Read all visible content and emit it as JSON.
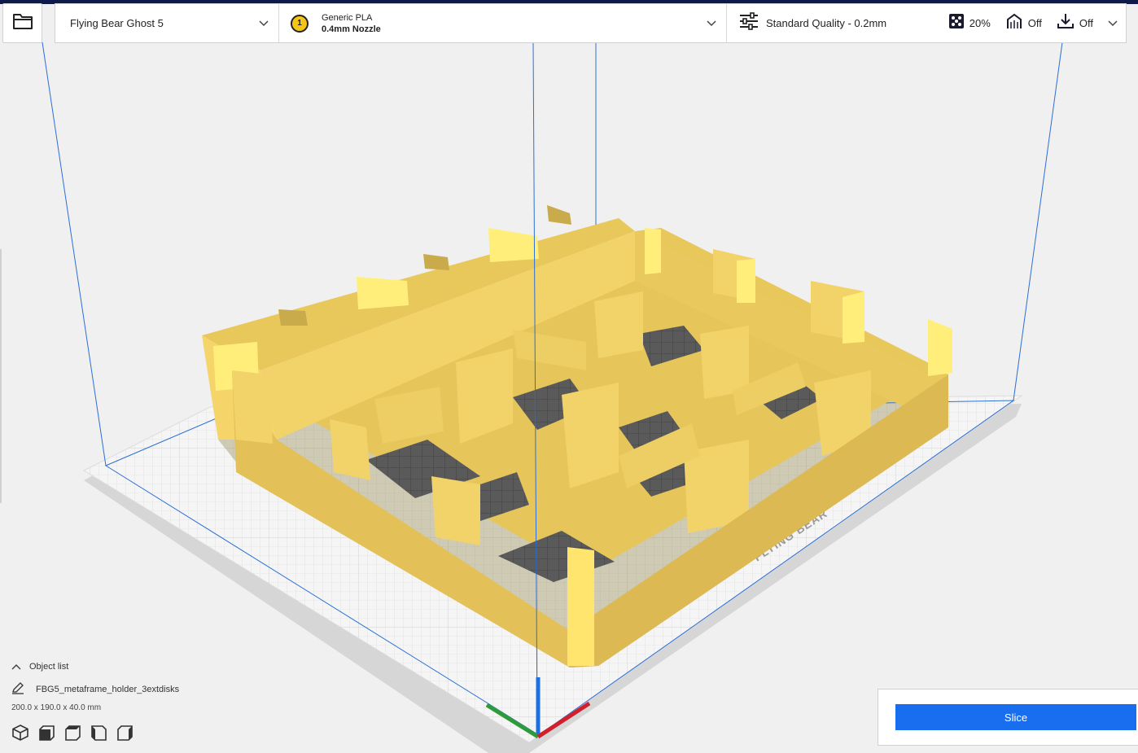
{
  "colors": {
    "accent": "#196ef0",
    "model_fill": "#f7d86a",
    "plate": "#f4f4f4",
    "grid_line": "#c8c8c8",
    "build_volume_line": "#2b6fd6",
    "header_bar": "#0d1a4a",
    "axis_x": "#d0202e",
    "axis_y": "#2e9a3a",
    "axis_z": "#1f6fe0"
  },
  "toolbar": {
    "open_icon": "folder-icon",
    "printer": {
      "name": "Flying Bear Ghost 5",
      "dropdown_icon": "chevron-down-icon"
    },
    "material": {
      "extruder_number": "1",
      "name": "Generic PLA",
      "nozzle": "0.4mm Nozzle",
      "dropdown_icon": "chevron-down-icon"
    },
    "print_settings": {
      "profile": "Standard Quality - 0.2mm",
      "profile_icon": "sliders-icon",
      "infill": "20%",
      "infill_icon": "infill-icon",
      "support": "Off",
      "support_icon": "support-icon",
      "adhesion": "Off",
      "adhesion_icon": "adhesion-icon",
      "dropdown_icon": "chevron-down-icon"
    }
  },
  "viewport": {
    "plate_logo": "FLYING BEAR"
  },
  "object_list": {
    "toggle_icon": "chevron-up-icon",
    "label": "Object list",
    "edit_icon": "pencil-icon",
    "object_name": "FBG5_metaframe_holder_3extdisks",
    "dimensions": "200.0 x 190.0 x 40.0 mm",
    "view_buttons": [
      {
        "icon": "view-3d-icon"
      },
      {
        "icon": "view-front-icon"
      },
      {
        "icon": "view-top-icon"
      },
      {
        "icon": "view-left-icon"
      },
      {
        "icon": "view-right-icon"
      }
    ]
  },
  "action_panel": {
    "slice_label": "Slice"
  }
}
